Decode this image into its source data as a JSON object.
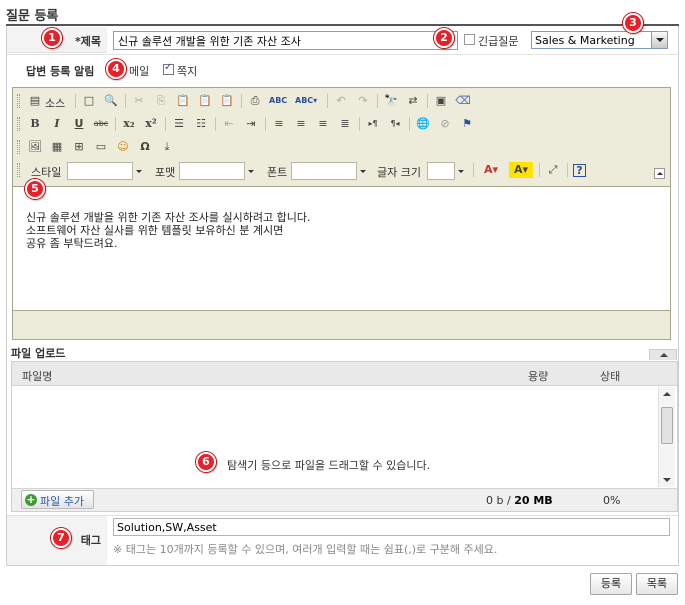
{
  "page": {
    "title": "질문 등록"
  },
  "form": {
    "title_label": "*제목",
    "title_value": "신규 솔루션 개발을 위한 기존 자산 조사",
    "urgent_label": "긴급질문",
    "category_value": "Sales & Marketing",
    "notice_label": "답변 등록 알림",
    "mail_label": "메일",
    "note_label": "쪽지"
  },
  "editor": {
    "source_label": "소스",
    "style_label": "스타일",
    "format_label": "포맷",
    "font_label": "폰트",
    "size_label": "글자 크기",
    "content": [
      "신규 솔루션 개발을 위한 기존 자산 조사를 실시하려고 합니다.",
      "소프트웨어 자산 실사를 위한 템플릿 보유하신 분 계시면",
      "공유 좀 부탁드려요."
    ]
  },
  "upload": {
    "section_label": "파일 업로드",
    "col_filename": "파일명",
    "col_size": "용량",
    "col_status": "상태",
    "drop_hint": "탐색기 등으로 파일을 드래그할 수 있습니다.",
    "add_button": "파일 추가",
    "size_used": "0 b",
    "size_sep": " / ",
    "size_max": "20 MB",
    "percent": "0%"
  },
  "tags": {
    "label": "태그",
    "value": "Solution,SW,Asset",
    "help": "※ 태그는 10개까지 등록할 수 있으며, 여러개 입력할 때는 쉼표(,)로 구분해 주세요."
  },
  "buttons": {
    "register": "등록",
    "list": "목록"
  },
  "callouts": [
    "1",
    "2",
    "3",
    "4",
    "5",
    "6",
    "7"
  ],
  "colors": {
    "callout": "#e8202a",
    "editor_bg": "#edebd9",
    "link": "#2a5aa5"
  }
}
